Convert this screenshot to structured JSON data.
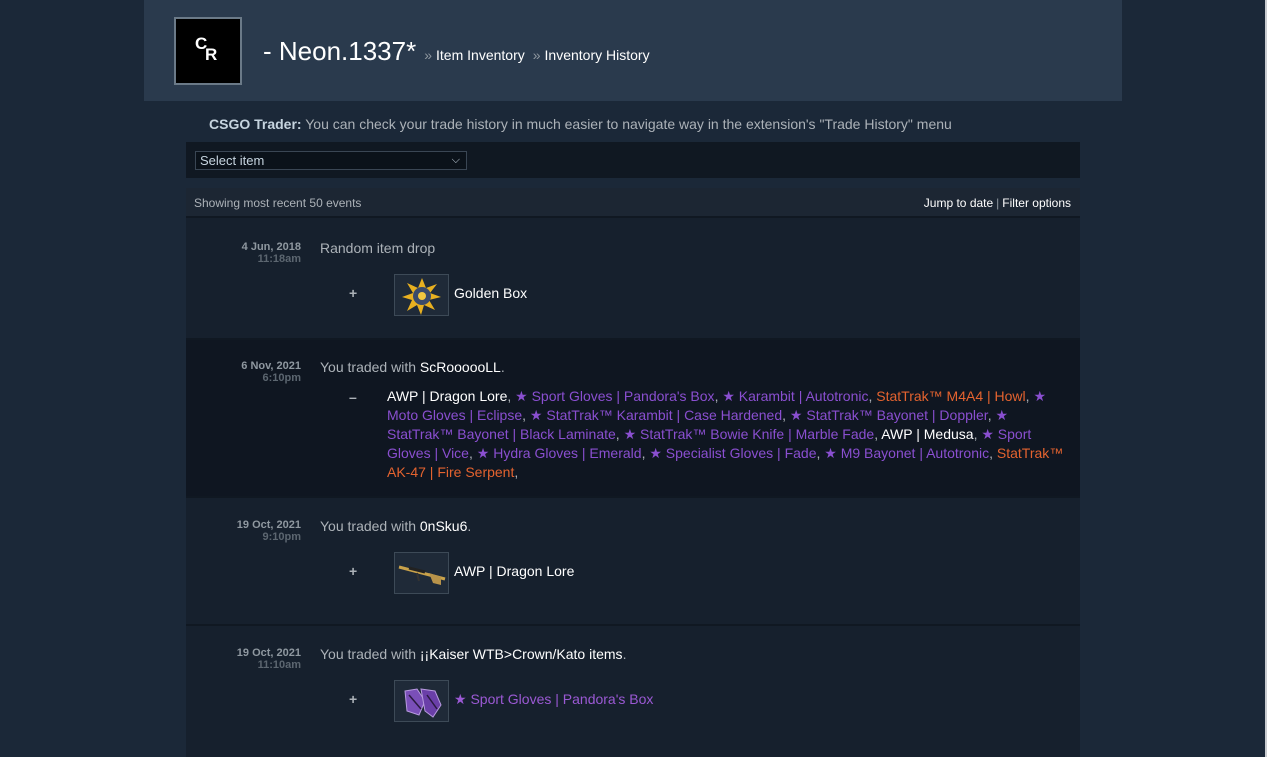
{
  "header": {
    "profile_name": "- Neon.1337*",
    "breadcrumbs": [
      "Item Inventory",
      "Inventory History"
    ],
    "breadcrumb_separator": "»"
  },
  "notice": {
    "label": "CSGO Trader:",
    "text": " You can check your trade history in much easier to navigate way in the extension's \"Trade History\" menu"
  },
  "filter": {
    "select_value": "Select item"
  },
  "panel": {
    "showing_text": "Showing most recent 50 events",
    "jump_label": "Jump to date",
    "filter_label": "Filter options",
    "separator": "|"
  },
  "colors": {
    "covert_purple": "#8a4fd0",
    "stattrak_orange": "#e4632f",
    "normal_white": "#ffffff"
  },
  "events": [
    {
      "date": "4 Jun, 2018",
      "time": "11:18am",
      "description": "Random item drop",
      "sign": "+",
      "item": "Golden Box",
      "icon": "golden-box-icon"
    },
    {
      "date": "6 Nov, 2021",
      "time": "6:10pm",
      "description_prefix": "You traded with ",
      "partner": "ScRoooooLL",
      "suffix": ".",
      "sign": "–",
      "items": [
        {
          "name": "AWP | Dragon Lore",
          "rarity": "white"
        },
        {
          "name": "★ Sport Gloves | Pandora's Box",
          "rarity": "purple"
        },
        {
          "name": "★ Karambit | Autotronic",
          "rarity": "purple"
        },
        {
          "name": "StatTrak™ M4A4 | Howl",
          "rarity": "orange"
        },
        {
          "name": "★ Moto Gloves | Eclipse",
          "rarity": "purple"
        },
        {
          "name": "★ StatTrak™ Karambit | Case Hardened",
          "rarity": "purple"
        },
        {
          "name": "★ StatTrak™ Bayonet | Doppler",
          "rarity": "purple"
        },
        {
          "name": "★ StatTrak™ Bayonet | Black Laminate",
          "rarity": "purple"
        },
        {
          "name": "★ StatTrak™ Bowie Knife | Marble Fade",
          "rarity": "purple"
        },
        {
          "name": "AWP | Medusa",
          "rarity": "white"
        },
        {
          "name": "★ Sport Gloves | Vice",
          "rarity": "purple"
        },
        {
          "name": "★ Hydra Gloves | Emerald",
          "rarity": "purple"
        },
        {
          "name": "★ Specialist Gloves | Fade",
          "rarity": "purple"
        },
        {
          "name": "★ M9 Bayonet | Autotronic",
          "rarity": "purple"
        },
        {
          "name": "StatTrak™ AK-47 | Fire Serpent",
          "rarity": "orange"
        }
      ]
    },
    {
      "date": "19 Oct, 2021",
      "time": "9:10pm",
      "description_prefix": "You traded with ",
      "partner": "0nSku6",
      "suffix": ".",
      "sign": "+",
      "item": "AWP | Dragon Lore",
      "icon": "awp-rifle-icon"
    },
    {
      "date": "19 Oct, 2021",
      "time": "11:10am",
      "description_prefix": "You traded with ",
      "partner": "¡¡Kaiser WTB>Crown/Kato items",
      "suffix": ".",
      "sign": "+",
      "item": "★ Sport Gloves | Pandora's Box",
      "icon": "gloves-icon"
    }
  ]
}
